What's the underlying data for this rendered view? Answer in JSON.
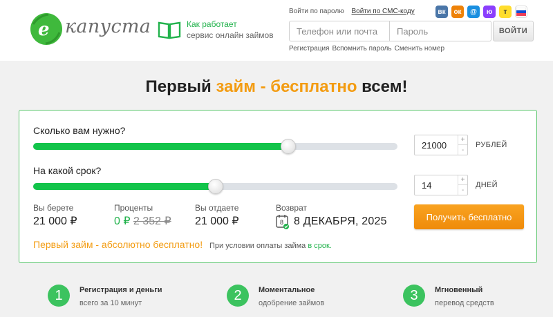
{
  "header": {
    "logo_text": "капуста",
    "how": {
      "line1": "Как работает",
      "line2": "сервис онлайн займов"
    },
    "login_by_password": "Войти по паролю",
    "login_by_sms": "Войти по СМС-коду",
    "social": [
      {
        "icon": "vk-icon",
        "glyph": "вк",
        "color": "#4a76a8"
      },
      {
        "icon": "ok-icon",
        "glyph": "ок",
        "color": "#ee8208"
      },
      {
        "icon": "mail-icon",
        "glyph": "@",
        "color": "#1a8fe0"
      },
      {
        "icon": "yoomoney-icon",
        "glyph": "ю",
        "color": "#8b3ffd"
      },
      {
        "icon": "tinkoff-icon",
        "glyph": "т",
        "color": "#ffdd2d"
      },
      {
        "icon": "gosuslugi-icon",
        "glyph": "",
        "color": "#ffffff"
      }
    ],
    "phone_placeholder": "Телефон или почта",
    "password_placeholder": "Пароль",
    "login_button": "ВОЙТИ",
    "register": "Регистрация",
    "recover": "Вспомнить пароль",
    "change_number": "Сменить номер"
  },
  "headline": {
    "part1": "Первый ",
    "accent": "займ - бесплатно",
    "part2": " всем!"
  },
  "calculator": {
    "amount_question": "Сколько вам нужно?",
    "amount_value": "21000",
    "amount_unit": "РУБЛЕЙ",
    "amount_fraction": 0.7,
    "term_question": "На какой срок?",
    "term_value": "14",
    "term_unit": "ДНЕЙ",
    "term_fraction": 0.5,
    "plus": "+",
    "minus": "-",
    "take_label": "Вы берете",
    "take_value": "21 000 ₽",
    "interest_label": "Проценты",
    "interest_new": "0 ₽",
    "interest_old": "2 352 ₽",
    "give_label": "Вы отдаете",
    "give_value": "21 000 ₽",
    "return_label": "Возврат",
    "calendar_day": "8",
    "return_date": "8 ДЕКАБРЯ, 2025",
    "cta": "Получить бесплатно",
    "promo": "Первый займ - абсолютно бесплатно!",
    "condition_prefix": "При условии оплаты займа ",
    "condition_link": "в срок."
  },
  "steps": [
    {
      "num": "1",
      "title": "Регистрация и деньги",
      "sub": "всего за 10 минут"
    },
    {
      "num": "2",
      "title": "Моментальное",
      "sub": "одобрение займов"
    },
    {
      "num": "3",
      "title": "Мгновенный",
      "sub": "перевод средств"
    }
  ]
}
